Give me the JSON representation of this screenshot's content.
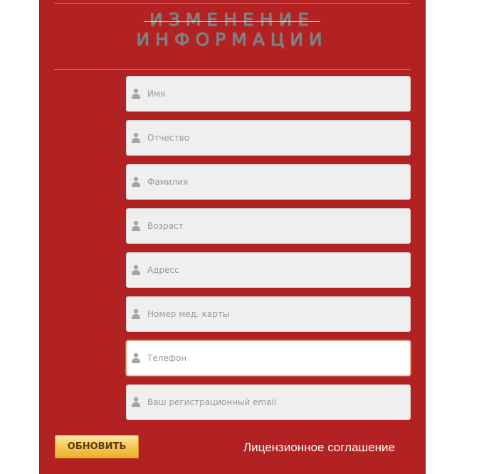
{
  "title": {
    "line1": "ИЗМЕНЕНИЕ",
    "line2": "ИНФОРМАЦИИ"
  },
  "fields": [
    {
      "placeholder": "Имя",
      "value": "",
      "icon": "user-icon"
    },
    {
      "placeholder": "Отчество",
      "value": "",
      "icon": "user-icon"
    },
    {
      "placeholder": "Фамилия",
      "value": "",
      "icon": "user-icon"
    },
    {
      "placeholder": "Возраст",
      "value": "",
      "icon": "user-icon"
    },
    {
      "placeholder": "Адресс",
      "value": "",
      "icon": "user-icon"
    },
    {
      "placeholder": "Номер мед. карты",
      "value": "",
      "icon": "user-icon"
    },
    {
      "placeholder": "Телефон",
      "value": "",
      "icon": "user-icon",
      "focused": true
    },
    {
      "placeholder": "Ваш регистрационный email",
      "value": "",
      "icon": "user-icon"
    }
  ],
  "actions": {
    "update_label": "ОБНОВИТЬ",
    "license_label": "Лицензионное соглашение"
  },
  "colors": {
    "panel": "#b22222",
    "button": "#f6c453",
    "title": "#7f7f7f",
    "focus_border": "#f0b890"
  }
}
